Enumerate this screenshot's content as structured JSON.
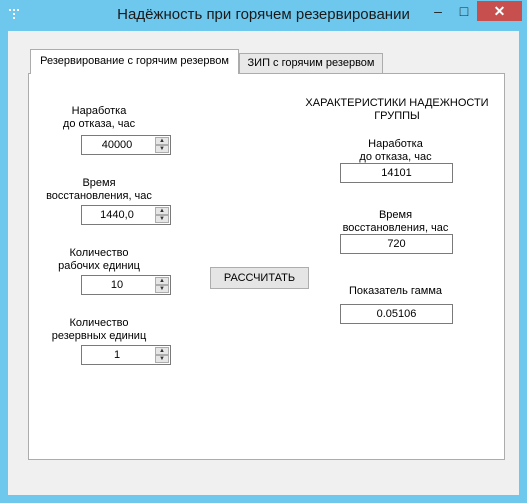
{
  "window": {
    "title": "Надёжность при горячем резервировании",
    "controls": {
      "minimize": "–",
      "maximize": "□",
      "close": "✕"
    }
  },
  "tabs": [
    {
      "label": "Резервирование с горячим резервом",
      "active": true
    },
    {
      "label": "ЗИП с горячим резервом",
      "active": false
    }
  ],
  "inputs": {
    "mtbf": {
      "label": "Наработка\nдо отказа, час",
      "value": "40000"
    },
    "repair_time": {
      "label": "Время\nвосстановления, час",
      "value": "1440,0"
    },
    "working_units": {
      "label": "Количество\nрабочих единиц",
      "value": "10"
    },
    "reserve_units": {
      "label": "Количество\nрезервных единиц",
      "value": "1"
    }
  },
  "calculate_button": "РАССЧИТАТЬ",
  "results": {
    "header": "ХАРАКТЕРИСТИКИ НАДЕЖНОСТИ\nГРУППЫ",
    "mtbf": {
      "label": "Наработка\nдо отказа, час",
      "value": "14101"
    },
    "repair_time": {
      "label": "Время\nвосстановления, час",
      "value": "720"
    },
    "gamma": {
      "label": "Показатель гамма",
      "value": "0.05106"
    }
  },
  "colors": {
    "frame": "#6ec8ee",
    "close": "#c7504e",
    "panel": "#ffffff",
    "client": "#f0f0f0"
  },
  "icons": {
    "app": "app-icon",
    "spin_up": "chevron-up-icon",
    "spin_down": "chevron-down-icon"
  }
}
